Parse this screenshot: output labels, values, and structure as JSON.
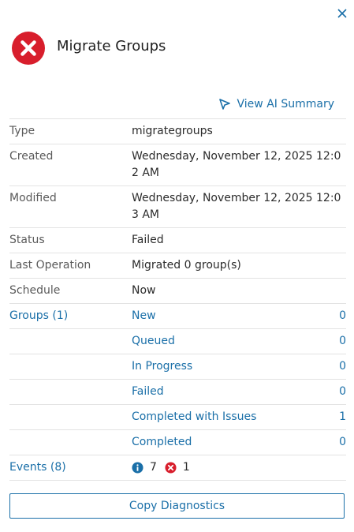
{
  "header": {
    "title": "Migrate Groups",
    "status_icon": "error-circle-icon",
    "status_color": "#d81e2c"
  },
  "ai_summary": {
    "label": "View AI Summary",
    "icon": "ai-sparkle-icon"
  },
  "details": {
    "type": {
      "label": "Type",
      "value": "migrategroups"
    },
    "created": {
      "label": "Created",
      "value": "Wednesday, November 12, 2025 12:02 AM"
    },
    "modified": {
      "label": "Modified",
      "value": "Wednesday, November 12, 2025 12:03 AM"
    },
    "status": {
      "label": "Status",
      "value": "Failed"
    },
    "last_operation": {
      "label": "Last Operation",
      "value": "Migrated 0 group(s)"
    },
    "schedule": {
      "label": "Schedule",
      "value": "Now"
    }
  },
  "groups": {
    "label": "Groups (1)",
    "items": [
      {
        "label": "New",
        "count": "0"
      },
      {
        "label": "Queued",
        "count": "0"
      },
      {
        "label": "In Progress",
        "count": "0"
      },
      {
        "label": "Failed",
        "count": "0"
      },
      {
        "label": "Completed with Issues",
        "count": "1"
      },
      {
        "label": "Completed",
        "count": "0"
      }
    ]
  },
  "events": {
    "label": "Events (8)",
    "info_count": "7",
    "error_count": "1"
  },
  "actions": {
    "copy_diagnostics": "Copy Diagnostics"
  },
  "colors": {
    "link": "#1a6fa8",
    "error": "#d81e2c",
    "divider": "#e3e3e3"
  }
}
